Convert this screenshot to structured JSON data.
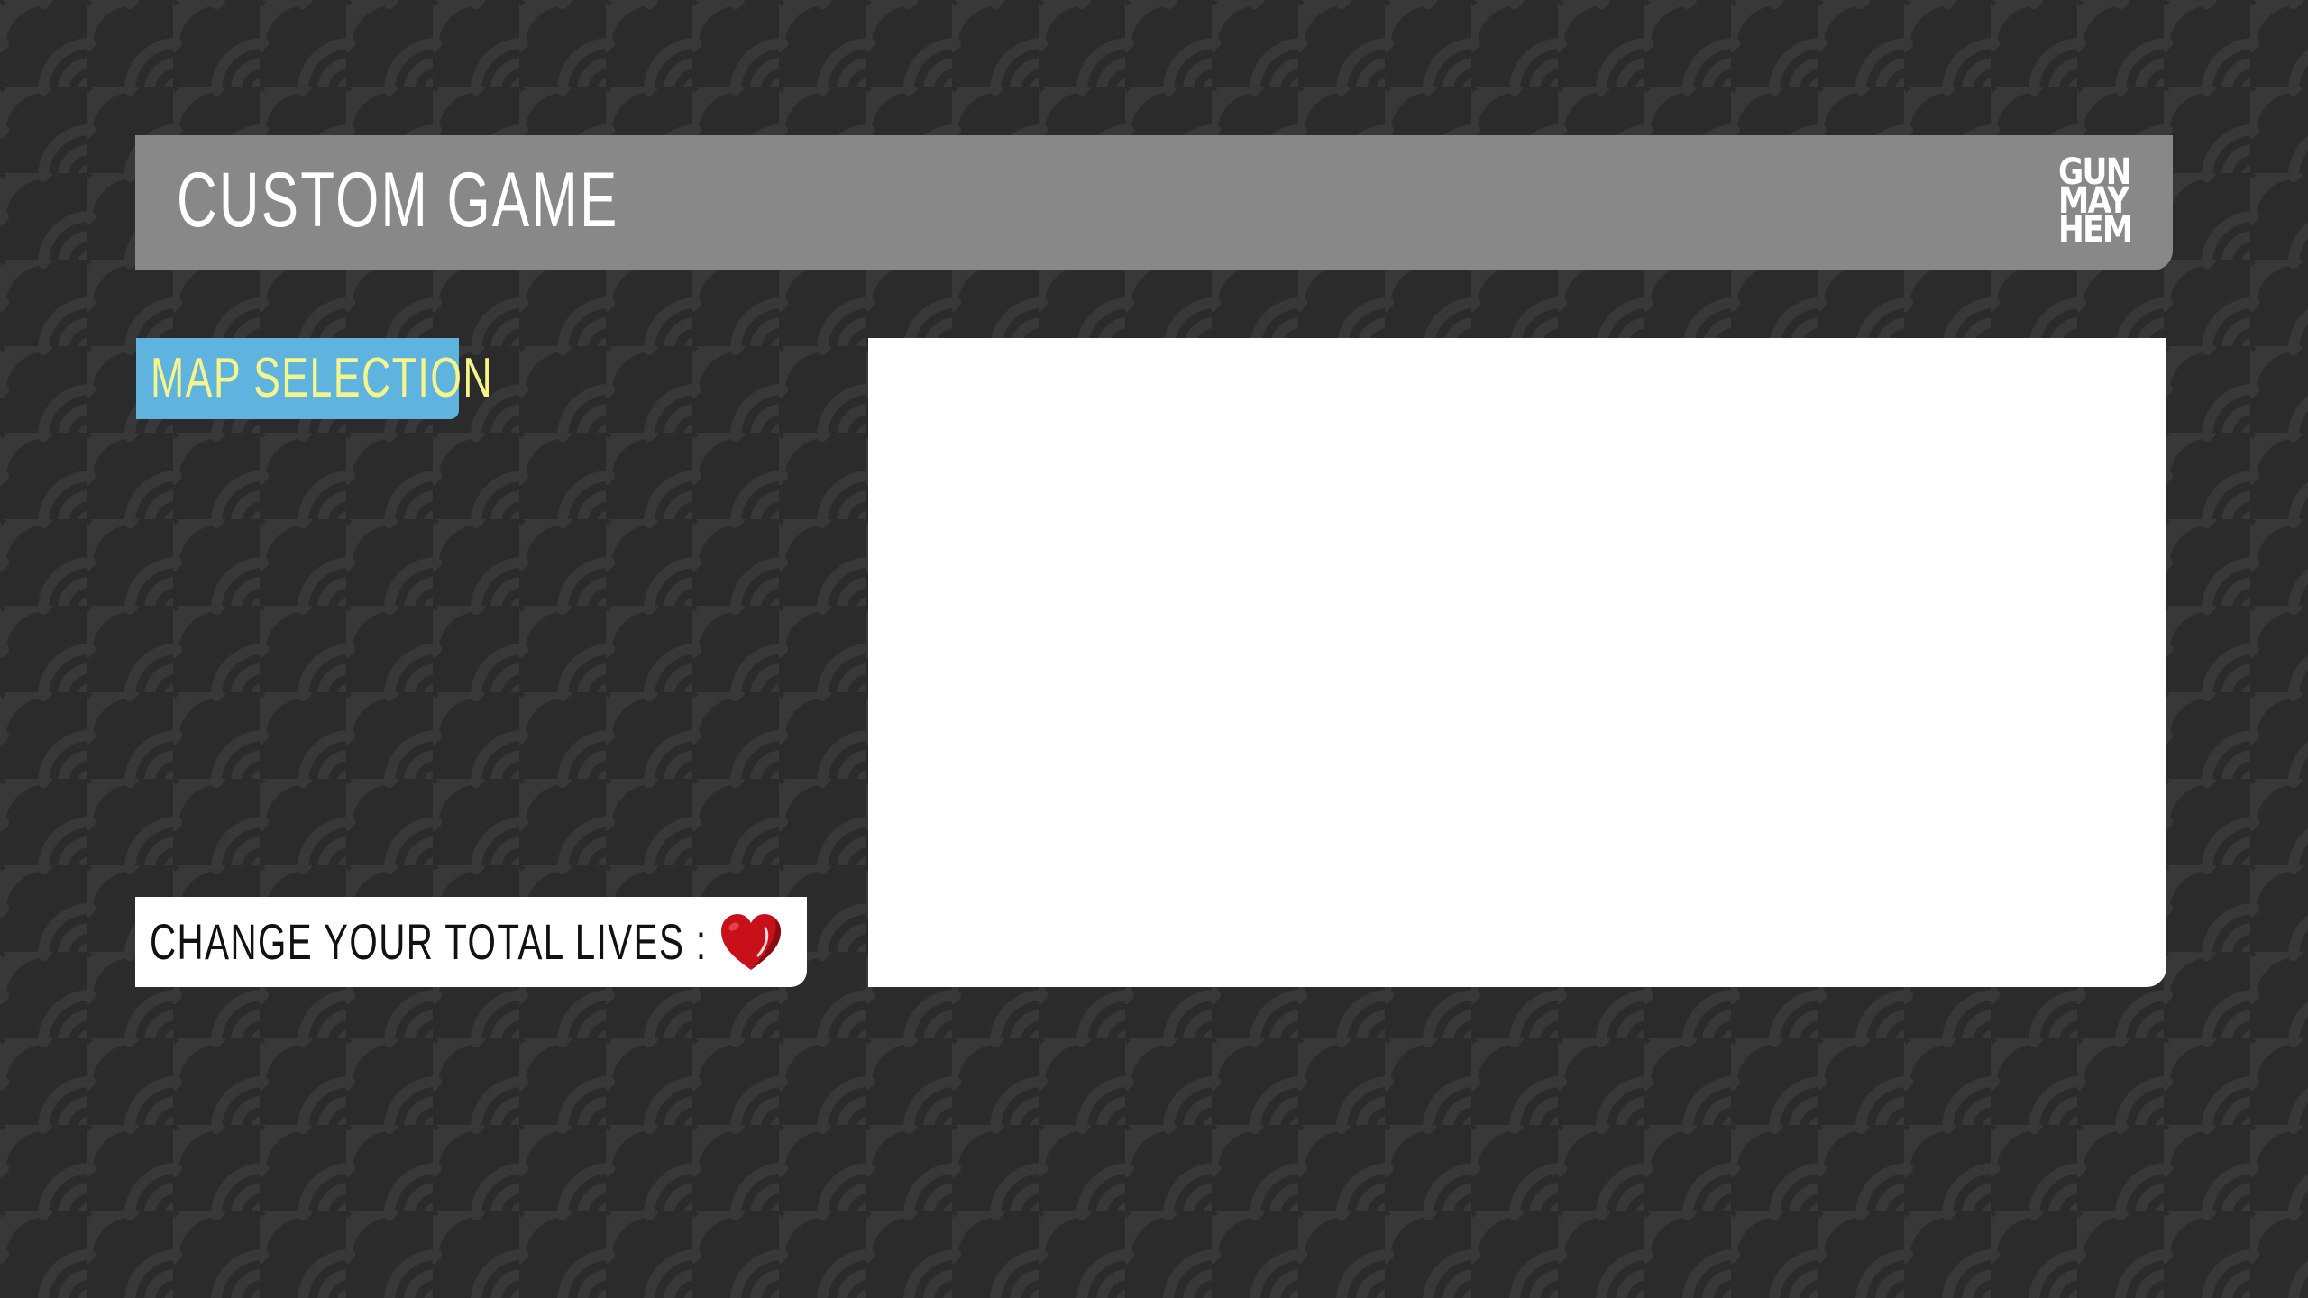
{
  "header": {
    "title": "CUSTOM GAME",
    "logo_lines": [
      "GUN",
      "MAY",
      "HEM"
    ]
  },
  "map_selection": {
    "label": "MAP SELECTION"
  },
  "lives": {
    "label": "CHANGE YOUR TOTAL LIVES :",
    "icon": "heart-icon"
  },
  "preview_panel": {},
  "colors": {
    "background": "#2b2b2b",
    "pattern": "#363636",
    "header_bar": "#888888",
    "map_tab": "#5fb3df",
    "map_tab_text": "#f6f58b",
    "heart": "#c8101a",
    "panel": "#ffffff"
  }
}
